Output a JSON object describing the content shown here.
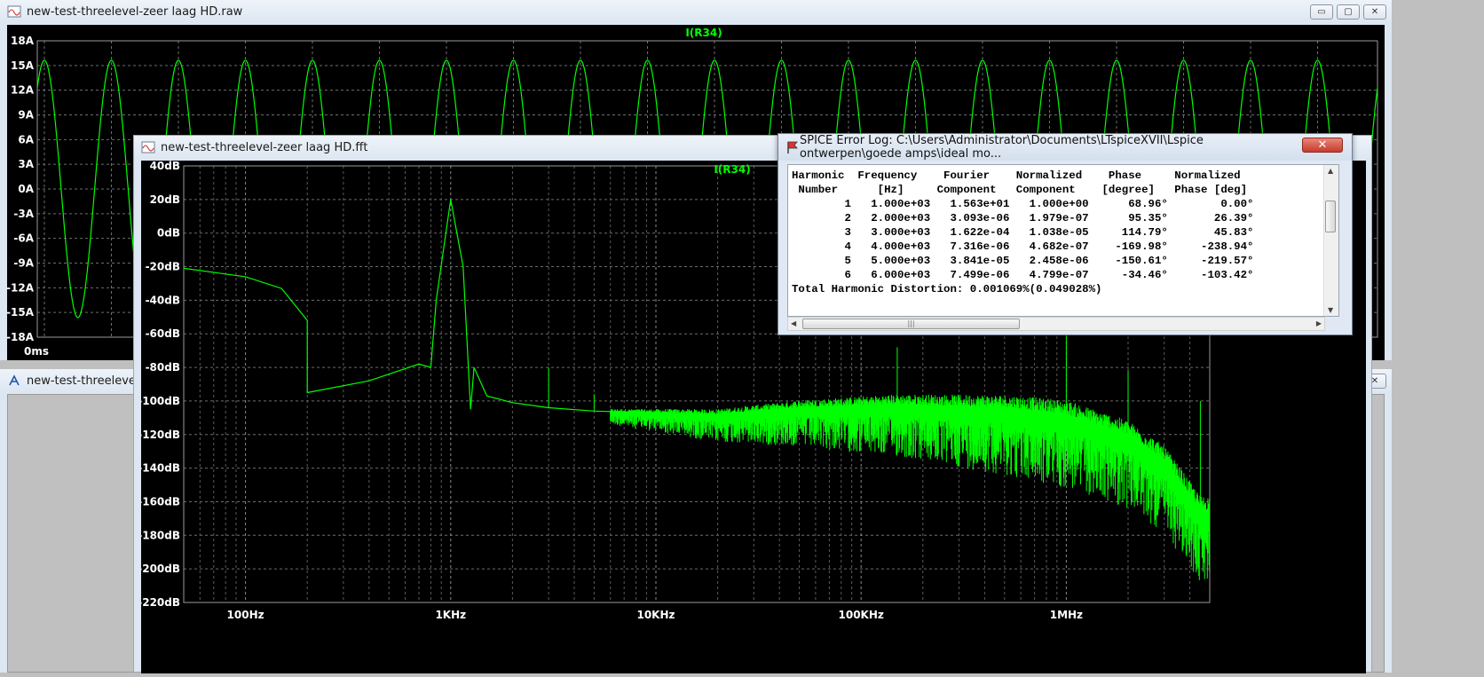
{
  "windows": {
    "raw": {
      "title": "new-test-threelevel-zeer laag HD.raw",
      "trace": "I(R34)",
      "x_tick": "0ms",
      "y_ticks": [
        "18A",
        "15A",
        "12A",
        "9A",
        "6A",
        "3A",
        "0A",
        "-3A",
        "-6A",
        "-9A",
        "-12A",
        "-15A",
        "-18A"
      ]
    },
    "schematic": {
      "title": "new-test-threelevel-zeer laag HD"
    },
    "fft": {
      "title": "new-test-threelevel-zeer laag HD.fft",
      "trace": "I(R34)",
      "y_ticks": [
        "40dB",
        "20dB",
        "0dB",
        "-20dB",
        "-40dB",
        "-60dB",
        "-80dB",
        "-100dB",
        "-120dB",
        "-140dB",
        "-160dB",
        "-180dB",
        "-200dB",
        "-220dB"
      ],
      "x_ticks": [
        "100Hz",
        "1KHz",
        "10KHz",
        "100KHz",
        "1MHz"
      ]
    },
    "error_log": {
      "title": "SPICE Error Log: C:\\Users\\Administrator\\Documents\\LTspiceXVII\\Lspice ontwerpen\\goede amps\\ideal mo...",
      "headers": [
        [
          "Harmonic",
          "Frequency",
          "Fourier",
          "Normalized",
          "Phase",
          "Normalized"
        ],
        [
          "Number",
          "[Hz]",
          "Component",
          "Component",
          "[degree]",
          "Phase [deg]"
        ]
      ],
      "rows": [
        [
          "1",
          "1.000e+03",
          "1.563e+01",
          "1.000e+00",
          "68.96°",
          "0.00°"
        ],
        [
          "2",
          "2.000e+03",
          "3.093e-06",
          "1.979e-07",
          "95.35°",
          "26.39°"
        ],
        [
          "3",
          "3.000e+03",
          "1.622e-04",
          "1.038e-05",
          "114.79°",
          "45.83°"
        ],
        [
          "4",
          "4.000e+03",
          "7.316e-06",
          "4.682e-07",
          "-169.98°",
          "-238.94°"
        ],
        [
          "5",
          "5.000e+03",
          "3.841e-05",
          "2.458e-06",
          "-150.61°",
          "-219.57°"
        ],
        [
          "6",
          "6.000e+03",
          "7.499e-06",
          "4.799e-07",
          "-34.46°",
          "-103.42°"
        ]
      ],
      "thd": "Total Harmonic Distortion: 0.001069%(0.049028%)"
    }
  },
  "buttons": {
    "minimize": "▭",
    "maximize": "▢",
    "close": "✕"
  },
  "colors": {
    "trace": "#00ff00",
    "plot_bg": "#000000",
    "grid": "#7a7a7a"
  },
  "chart_data": [
    {
      "type": "line",
      "title": "I(R34)",
      "xlabel": "",
      "ylabel": "",
      "ylim": [
        -18,
        18
      ],
      "y_unit": "A",
      "description": "sine wave, amplitude ~15.6 A, 1 kHz",
      "series": [
        {
          "name": "I(R34)",
          "amplitude": 15.63
        }
      ]
    },
    {
      "type": "line",
      "title": "I(R34)",
      "x_scale": "log",
      "xlim_hz": [
        50,
        5000000
      ],
      "ylim": [
        -220,
        40
      ],
      "y_unit": "dB",
      "series": [
        {
          "name": "I(R34)",
          "x": [
            50,
            100,
            150,
            200,
            200,
            400,
            700,
            800,
            850,
            1000,
            1150,
            1250,
            1300,
            1500,
            2000,
            3000,
            5000,
            20000,
            50000,
            150000,
            500000,
            1000000,
            2000000,
            3000000,
            4500000
          ],
          "y": [
            -21,
            -26,
            -33,
            -52,
            -95,
            -88,
            -78,
            -80,
            -40,
            20,
            -20,
            -105,
            -80,
            -97,
            -101,
            -104,
            -106,
            -108,
            -104,
            -102,
            -104,
            -108,
            -120,
            -135,
            -165
          ]
        }
      ]
    }
  ]
}
